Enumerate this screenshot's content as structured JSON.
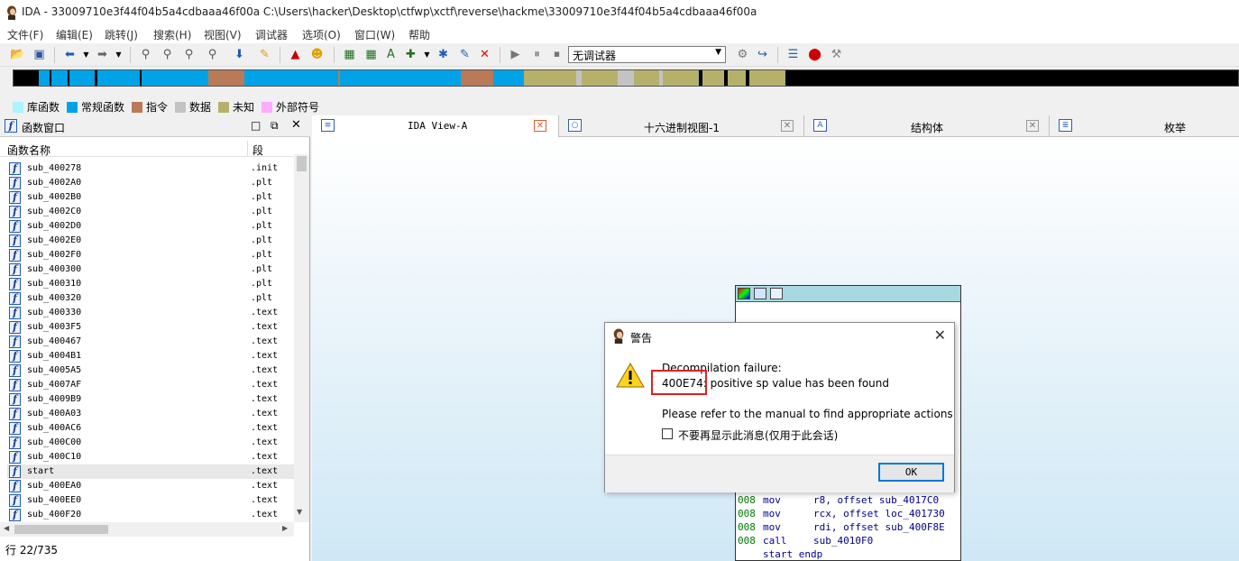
{
  "window": {
    "title": "IDA - 33009710e3f44f04b5a4cdbaaa46f00a C:\\Users\\hacker\\Desktop\\ctfwp\\xctf\\reverse\\hackme\\33009710e3f44f04b5a4cdbaaa46f00a"
  },
  "menu": [
    "文件(F)",
    "编辑(E)",
    "跳转(J)",
    "搜索(H)",
    "视图(V)",
    "调试器",
    "选项(O)",
    "窗口(W)",
    "帮助"
  ],
  "toolbar": {
    "debugger_select": "无调试器"
  },
  "legend": [
    {
      "label": "库函数",
      "color": "#aaf5ff"
    },
    {
      "label": "常规函数",
      "color": "#00a2e8"
    },
    {
      "label": "指令",
      "color": "#b97a57"
    },
    {
      "label": "数据",
      "color": "#c3c3c3"
    },
    {
      "label": "未知",
      "color": "#b5b16b"
    },
    {
      "label": "外部符号",
      "color": "#ffaaff"
    }
  ],
  "functions_panel": {
    "title": "函数窗口",
    "col_name": "函数名称",
    "col_segment": "段",
    "rows": [
      {
        "name": "sub_400278",
        "seg": ".init"
      },
      {
        "name": "sub_4002A0",
        "seg": ".plt"
      },
      {
        "name": "sub_4002B0",
        "seg": ".plt"
      },
      {
        "name": "sub_4002C0",
        "seg": ".plt"
      },
      {
        "name": "sub_4002D0",
        "seg": ".plt"
      },
      {
        "name": "sub_4002E0",
        "seg": ".plt"
      },
      {
        "name": "sub_4002F0",
        "seg": ".plt"
      },
      {
        "name": "sub_400300",
        "seg": ".plt"
      },
      {
        "name": "sub_400310",
        "seg": ".plt"
      },
      {
        "name": "sub_400320",
        "seg": ".plt"
      },
      {
        "name": "sub_400330",
        "seg": ".text"
      },
      {
        "name": "sub_4003F5",
        "seg": ".text"
      },
      {
        "name": "sub_400467",
        "seg": ".text"
      },
      {
        "name": "sub_4004B1",
        "seg": ".text"
      },
      {
        "name": "sub_4005A5",
        "seg": ".text"
      },
      {
        "name": "sub_4007AF",
        "seg": ".text"
      },
      {
        "name": "sub_4009B9",
        "seg": ".text"
      },
      {
        "name": "sub_400A03",
        "seg": ".text"
      },
      {
        "name": "sub_400AC6",
        "seg": ".text"
      },
      {
        "name": "sub_400C00",
        "seg": ".text"
      },
      {
        "name": "sub_400C10",
        "seg": ".text"
      },
      {
        "name": "start",
        "seg": ".text"
      },
      {
        "name": "sub_400EA0",
        "seg": ".text"
      },
      {
        "name": "sub_400EE0",
        "seg": ".text"
      },
      {
        "name": "sub_400F20",
        "seg": ".text"
      }
    ],
    "status": "行 22/735"
  },
  "tabs": [
    {
      "label": "IDA View-A"
    },
    {
      "label": "十六进制视图-1"
    },
    {
      "label": "结构体"
    },
    {
      "label": "枚举"
    }
  ],
  "graph": {
    "lines": [
      {
        "addr": "008",
        "op": "mov",
        "args": "r8, offset sub_4017C0"
      },
      {
        "addr": "008",
        "op": "mov",
        "args": "rcx, offset loc_401730"
      },
      {
        "addr": "008",
        "op": "mov",
        "args": "rdi, offset sub_400F8E"
      },
      {
        "addr": "008",
        "op": "call",
        "args": "sub_4010F0"
      },
      {
        "addr": "",
        "op": "start endp",
        "args": ""
      }
    ]
  },
  "dialog": {
    "title": "警告",
    "line1": "Decompilation failure:",
    "address": "400E74:",
    "line2_rest": " positive sp value has been found",
    "line3": "Please refer to the manual to find appropriate actions",
    "checkbox_label": "不要再显示此消息(仅用于此会话)",
    "ok_label": "OK"
  }
}
